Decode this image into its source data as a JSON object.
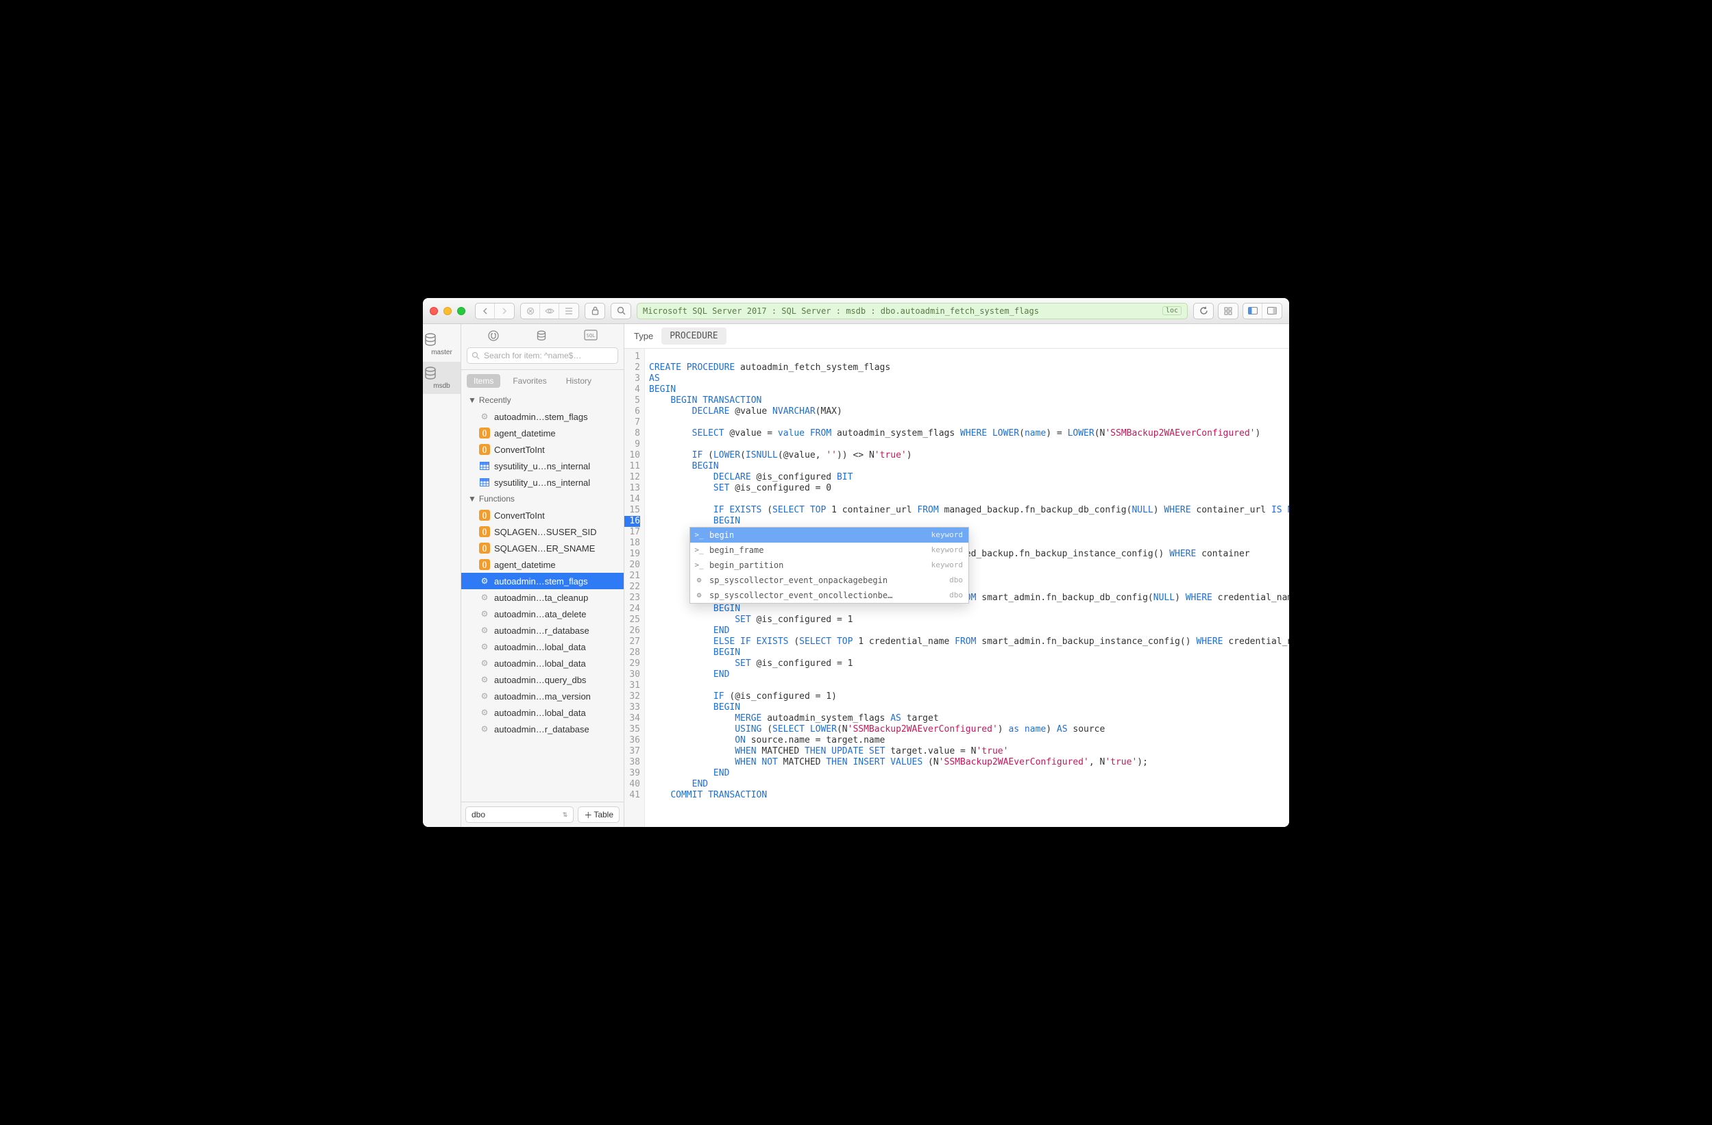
{
  "breadcrumb": {
    "text": "Microsoft SQL Server 2017 : SQL Server : msdb : dbo.autoadmin_fetch_system_flags",
    "tag": "loc"
  },
  "rail": {
    "items": [
      {
        "label": "master"
      },
      {
        "label": "msdb"
      }
    ]
  },
  "sidebar": {
    "search_placeholder": "Search for item: ^name$…",
    "tabs": {
      "items": "Items",
      "favorites": "Favorites",
      "history": "History"
    },
    "sections": {
      "recently": "Recently",
      "functions": "Functions"
    },
    "recently_items": [
      {
        "icon": "gear",
        "label": "autoadmin…stem_flags"
      },
      {
        "icon": "fn",
        "label": "agent_datetime"
      },
      {
        "icon": "fn",
        "label": "ConvertToInt"
      },
      {
        "icon": "tbl",
        "label": "sysutility_u…ns_internal"
      },
      {
        "icon": "tbl",
        "label": "sysutility_u…ns_internal"
      }
    ],
    "functions_items": [
      {
        "icon": "fn",
        "label": "ConvertToInt"
      },
      {
        "icon": "fn",
        "label": "SQLAGEN…SUSER_SID"
      },
      {
        "icon": "fn",
        "label": "SQLAGEN…ER_SNAME"
      },
      {
        "icon": "fn",
        "label": "agent_datetime"
      },
      {
        "icon": "gear",
        "label": "autoadmin…stem_flags",
        "selected": true
      },
      {
        "icon": "gear",
        "label": "autoadmin…ta_cleanup"
      },
      {
        "icon": "gear",
        "label": "autoadmin…ata_delete"
      },
      {
        "icon": "gear",
        "label": "autoadmin…r_database"
      },
      {
        "icon": "gear",
        "label": "autoadmin…lobal_data"
      },
      {
        "icon": "gear",
        "label": "autoadmin…lobal_data"
      },
      {
        "icon": "gear",
        "label": "autoadmin…query_dbs"
      },
      {
        "icon": "gear",
        "label": "autoadmin…ma_version"
      },
      {
        "icon": "gear",
        "label": "autoadmin…lobal_data"
      },
      {
        "icon": "gear",
        "label": "autoadmin…r_database"
      }
    ],
    "schema_select": "dbo",
    "add_button": "Table"
  },
  "main": {
    "type_label": "Type",
    "type_value": "PROCEDURE"
  },
  "autocomplete": {
    "items": [
      {
        "label": "begin",
        "kind": "keyword",
        "selected": true,
        "icon": "kw"
      },
      {
        "label": "begin_frame",
        "kind": "keyword",
        "icon": "kw"
      },
      {
        "label": "begin_partition",
        "kind": "keyword",
        "icon": "kw"
      },
      {
        "label": "sp_syscollector_event_onpackagebegin",
        "kind": "dbo",
        "icon": "gear"
      },
      {
        "label": "sp_syscollector_event_oncollectionbe…",
        "kind": "dbo",
        "icon": "gear"
      }
    ]
  },
  "code": {
    "highlighted_line": 16
  }
}
